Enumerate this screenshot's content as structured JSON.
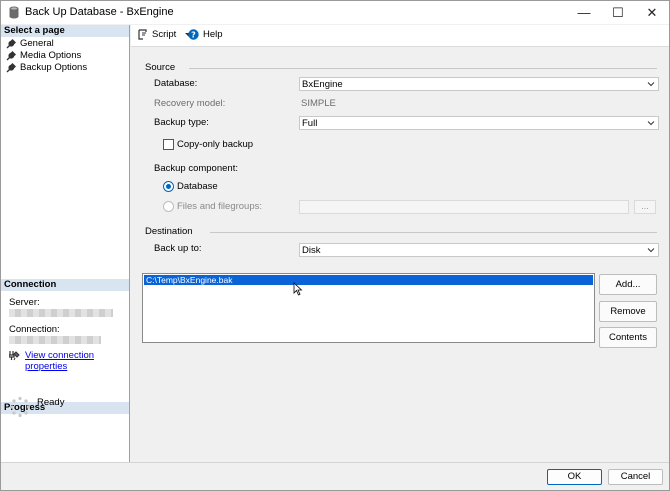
{
  "window": {
    "title": "Back Up Database - BxEngine",
    "minimize_glyph": "—",
    "maximize_glyph": "☐",
    "close_glyph": "✕"
  },
  "left_pane": {
    "select_page_header": "Select a page",
    "pages": [
      {
        "label": "General",
        "icon": "wrench-icon"
      },
      {
        "label": "Media Options",
        "icon": "wrench-icon"
      },
      {
        "label": "Backup Options",
        "icon": "wrench-icon"
      }
    ],
    "connection_header": "Connection",
    "server_label": "Server:",
    "connection_label": "Connection:",
    "view_connection_link": "View connection properties",
    "progress_header": "Progress",
    "progress_status": "Ready"
  },
  "toolbar": {
    "script_label": "Script",
    "help_label": "Help"
  },
  "source": {
    "group_label": "Source",
    "database_label": "Database:",
    "database_value": "BxEngine",
    "recovery_model_label": "Recovery model:",
    "recovery_model_value": "SIMPLE",
    "backup_type_label": "Backup type:",
    "backup_type_value": "Full",
    "copy_only_label": "Copy-only backup",
    "copy_only_checked": false,
    "backup_component_label": "Backup component:",
    "component_database_label": "Database",
    "component_files_label": "Files and filegroups:",
    "selected_component": "Database",
    "files_ellipsis": "..."
  },
  "destination": {
    "group_label": "Destination",
    "back_up_to_label": "Back up to:",
    "back_up_to_value": "Disk",
    "paths": [
      "C:\\Temp\\BxEngine.bak"
    ],
    "add_label": "Add...",
    "remove_label": "Remove",
    "contents_label": "Contents"
  },
  "footer": {
    "ok_label": "OK",
    "cancel_label": "Cancel"
  },
  "colors": {
    "selection": "#0a64d8",
    "accent": "#0067c0",
    "pane_header": "#d9e4f1",
    "link": "#0000ee"
  }
}
